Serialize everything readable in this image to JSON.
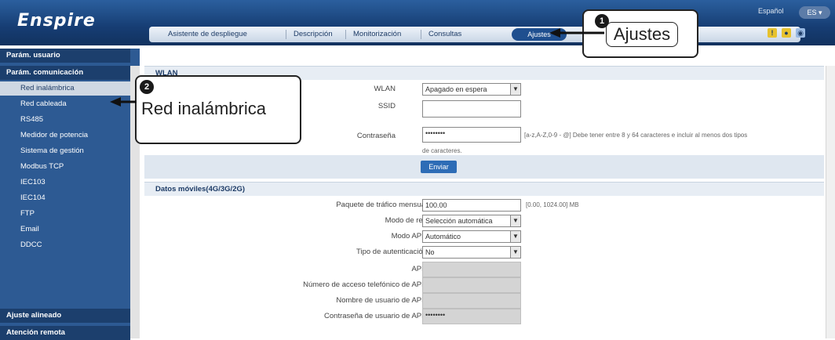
{
  "header": {
    "logo": "Enspire",
    "language": "Español",
    "tabs": [
      "Asistente de despliegue",
      "Descripción",
      "Monitorización",
      "Consultas",
      "Ajustes"
    ]
  },
  "callouts": {
    "ajustes": {
      "number": "1",
      "label": "Ajustes"
    },
    "red_inalambrica": {
      "number": "2",
      "label": "Red inalámbrica"
    }
  },
  "sidebar": {
    "groups": [
      {
        "label": "Parám. usuario",
        "items": []
      },
      {
        "label": "Parám. comunicación",
        "items": [
          "Red inalámbrica",
          "Red cableada",
          "RS485",
          "Medidor de potencia",
          "Sistema de gestión",
          "Modbus TCP",
          "IEC103",
          "IEC104",
          "FTP",
          "Email",
          "DDCC"
        ]
      },
      {
        "label": "Ajuste alineado",
        "items": []
      },
      {
        "label": "Atención remota",
        "items": []
      }
    ]
  },
  "wlan": {
    "section_title": "WLAN",
    "wlan_label": "WLAN",
    "wlan_value": "Apagado en espera",
    "ssid_label": "SSID",
    "ssid_value": "",
    "password_label": "Contraseña",
    "password_value": "••••••••",
    "password_hint": "[a-z,A-Z,0-9 - @] Debe tener entre 8 y 64 caracteres e incluir al menos dos tipos",
    "password_hint2": "de caracteres.",
    "send_label": "Enviar"
  },
  "mobile": {
    "section_title": "Datos móviles(4G/3G/2G)",
    "fields": [
      {
        "label": "Paquete de tráfico mensual",
        "value": "100.00",
        "hint": "[0.00, 1024.00] MB",
        "kind": "text"
      },
      {
        "label": "Modo de red",
        "value": "Selección automática",
        "kind": "select"
      },
      {
        "label": "Modo APN",
        "value": "Automático",
        "kind": "select"
      },
      {
        "label": "Tipo de autenticación",
        "value": "No",
        "kind": "select"
      },
      {
        "label": "APN",
        "value": "",
        "kind": "disabled"
      },
      {
        "label": "Número de acceso telefónico de APN",
        "value": "",
        "kind": "disabled"
      },
      {
        "label": "Nombre de usuario de APN",
        "value": "",
        "kind": "disabled"
      },
      {
        "label": "Contraseña de usuario de APN",
        "value": "••••••••",
        "kind": "disabled"
      }
    ]
  }
}
